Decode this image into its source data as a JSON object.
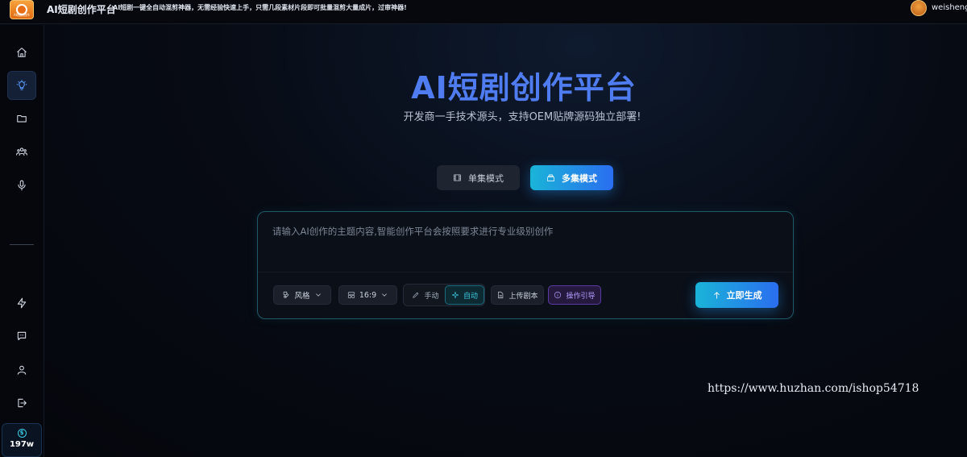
{
  "header": {
    "logo_text": "AI短剧创作",
    "app_title": "AI短剧创作平台",
    "tagline": "AI短剧一键全自动混剪神器，无需经验快速上手，只需几段素材片段即可批量混剪大量成片，过审神器!",
    "user_name": "weisheng"
  },
  "sidebar": {
    "top_items": [
      {
        "name": "home",
        "icon": "home-icon",
        "active": false
      },
      {
        "name": "create",
        "icon": "lightbulb-icon",
        "active": true
      },
      {
        "name": "projects",
        "icon": "folder-icon",
        "active": false
      },
      {
        "name": "characters",
        "icon": "users-icon",
        "active": false
      },
      {
        "name": "voice",
        "icon": "microphone-icon",
        "active": false
      }
    ],
    "bottom_items": [
      {
        "name": "upgrade",
        "icon": "lightning-icon"
      },
      {
        "name": "messages",
        "icon": "chat-icon"
      },
      {
        "name": "profile",
        "icon": "user-icon"
      },
      {
        "name": "logout",
        "icon": "logout-icon"
      }
    ],
    "credit": {
      "symbol": "$",
      "amount": "197w"
    }
  },
  "hero": {
    "title": "AI短剧创作平台",
    "subtitle": "开发商一手技术源头，支持OEM贴牌源码独立部署!"
  },
  "modes": {
    "single_label": "单集模式",
    "multi_label": "多集模式",
    "selected": "multi"
  },
  "composer": {
    "placeholder": "请输入AI创作的主题内容,智能创作平台会按照要求进行专业级别创作",
    "value": "",
    "style_label": "风格",
    "ratio_label": "16:9",
    "manual_label": "手动",
    "auto_label": "自动",
    "auto_selected": true,
    "upload_label": "上传剧本",
    "guide_label": "操作引导",
    "generate_label": "立即生成"
  },
  "colors": {
    "accent_gradient_start": "#1ab4d8",
    "accent_gradient_end": "#2a6ef0",
    "title_blue": "#4f7cf0",
    "guide_purple": "#b49bff"
  },
  "watermark": "https://www.huzhan.com/ishop54718"
}
